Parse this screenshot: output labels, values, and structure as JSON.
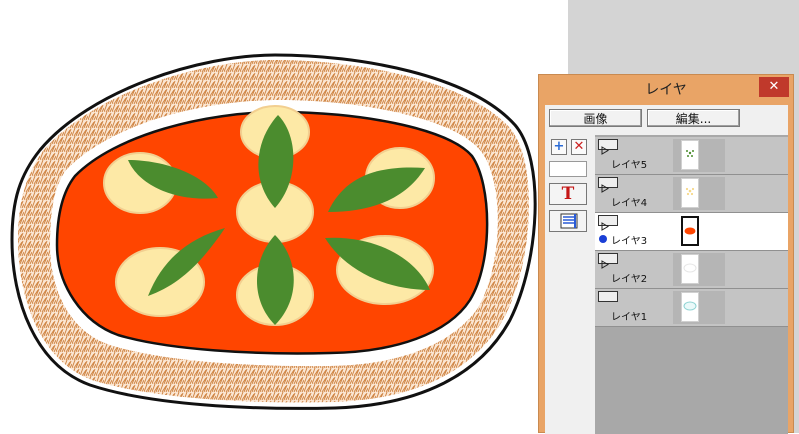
{
  "panel": {
    "title": "レイヤ",
    "close_glyph": "✕",
    "buttons": {
      "image": "画像",
      "edit": "編集..."
    },
    "tools": {
      "add_glyph": "+",
      "delete_glyph": "✕",
      "text_glyph": "T"
    },
    "layers": [
      {
        "name": "レイヤ5",
        "type": "raster",
        "selected": false
      },
      {
        "name": "レイヤ4",
        "type": "raster",
        "selected": false
      },
      {
        "name": "レイヤ3",
        "type": "raster",
        "selected": true
      },
      {
        "name": "レイヤ2",
        "type": "raster",
        "selected": false
      },
      {
        "name": "レイヤ1",
        "type": "paper",
        "selected": false
      }
    ]
  },
  "colors": {
    "workspace": "#d4d4d4",
    "panel_frame": "#e9a466",
    "close_button": "#c0392b",
    "crust": "#c8752e",
    "sauce": "#ff4500",
    "cheese": "#fde9a6",
    "basil": "#4b8c2e"
  },
  "icons": {
    "layer_type": "raster-layer-icon",
    "paper": "paper-layer-icon",
    "current": "current-layer-dot-icon",
    "text_tool": "text-t-icon",
    "properties": "layer-properties-icon"
  }
}
